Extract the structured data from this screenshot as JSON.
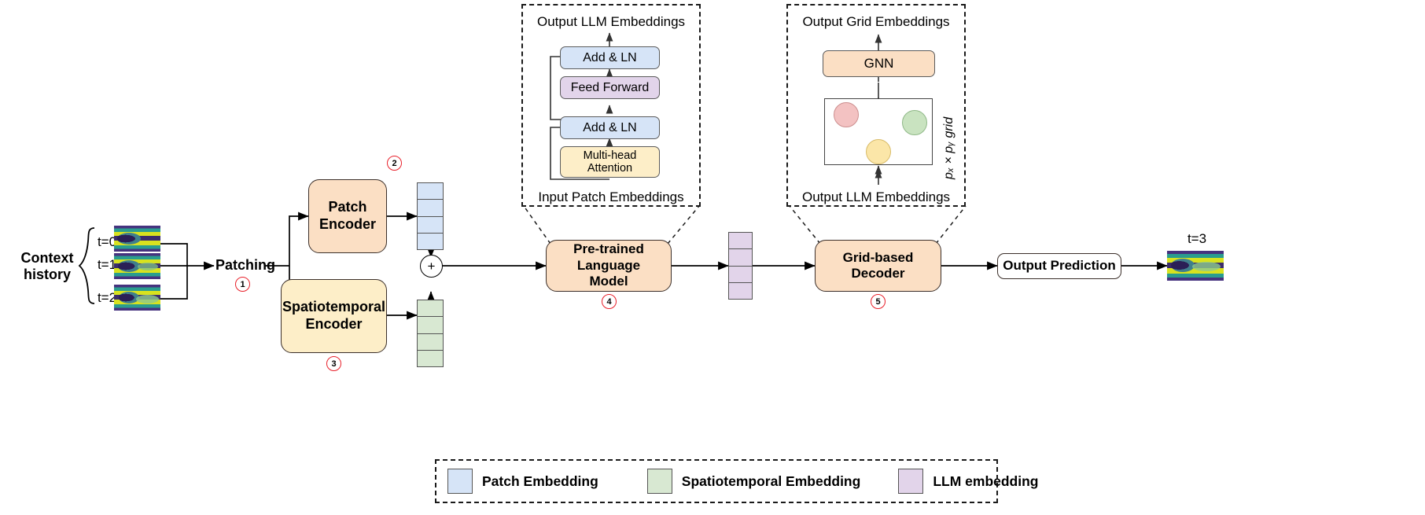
{
  "pipeline": {
    "context_history_label": "Context\nhistory",
    "context_frames": [
      {
        "time_label": "t=0"
      },
      {
        "time_label": "t=1"
      },
      {
        "time_label": "t=2"
      }
    ],
    "patching": {
      "label": "Patching",
      "badge": "1"
    },
    "patch_encoder": {
      "label": "Patch\nEncoder",
      "badge": "2"
    },
    "spatiotemporal_encoder": {
      "label": "Spatiotemporal\nEncoder",
      "badge": "3"
    },
    "sum_operator": "+",
    "language_model": {
      "label": "Pre-trained\nLanguage\nModel",
      "badge": "4"
    },
    "grid_decoder": {
      "label": "Grid-based\nDecoder",
      "badge": "5"
    },
    "output_prediction": {
      "label": "Output Prediction"
    },
    "output_frame": {
      "time_label": "t=3"
    }
  },
  "token_stacks": {
    "patch_tokens": {
      "count": 4,
      "color": "#d6e4f7"
    },
    "spatiotemporal_tokens": {
      "count": 4,
      "color": "#d8e8d2"
    },
    "llm_tokens": {
      "count": 4,
      "color": "#e2d4ea"
    }
  },
  "transformer_detail": {
    "top_label": "Output LLM Embeddings",
    "bottom_label": "Input Patch Embeddings",
    "blocks": [
      {
        "label": "Add & LN",
        "color": "#d6e4f7"
      },
      {
        "label": "Feed Forward",
        "color": "#e2d4ea"
      },
      {
        "label": "Add & LN",
        "color": "#d6e4f7"
      },
      {
        "label": "Multi-head\nAttention",
        "color": "#fdeec8"
      }
    ]
  },
  "decoder_detail": {
    "top_label": "Output Grid Embeddings",
    "bottom_label": "Output LLM Embeddings",
    "gnn_label": "GNN",
    "grid_label": "pₓ × pᵧ grid",
    "nodes": [
      {
        "name": "node-red",
        "color": "#f3c2c2"
      },
      {
        "name": "node-green",
        "color": "#c9e3c0"
      },
      {
        "name": "node-yellow",
        "color": "#fbe6a8"
      }
    ]
  },
  "legend": {
    "items": [
      {
        "label": "Patch Embedding",
        "color": "#d6e4f7"
      },
      {
        "label": "Spatiotemporal Embedding",
        "color": "#d8e8d2"
      },
      {
        "label": "LLM embedding",
        "color": "#e2d4ea"
      }
    ]
  }
}
